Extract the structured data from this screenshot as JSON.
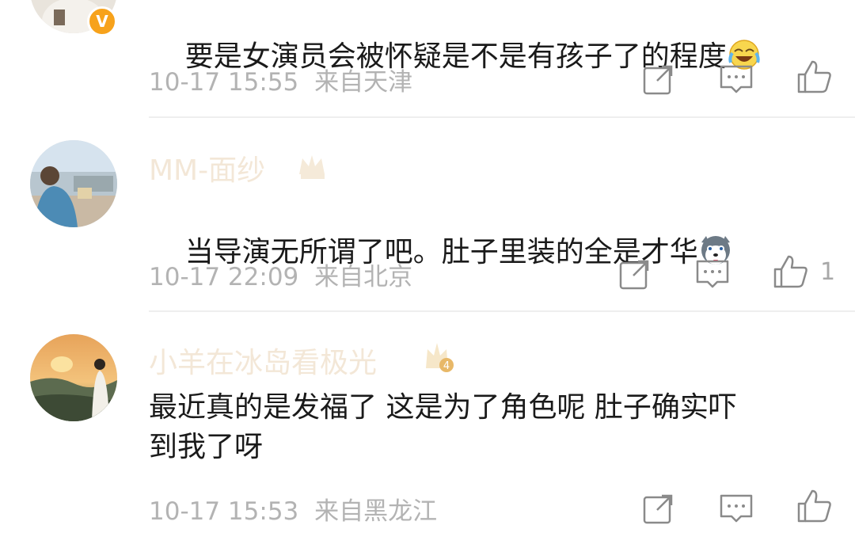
{
  "comments": [
    {
      "text": "要是女演员会被怀疑是不是有孩子了的程度",
      "emoji": "laugh-cry-emoji",
      "date": "10-17 15:55",
      "location": "来自天津",
      "likes": ""
    },
    {
      "username": "MM-面纱",
      "text": "当导演无所谓了吧。肚子里装的全是才华",
      "emoji": "husky-emoji",
      "date": "10-17 22:09",
      "location": "来自北京",
      "likes": "1"
    },
    {
      "username": "小羊在冰岛看极光",
      "level": "4",
      "text": "最近真的是发福了 这是为了角色呢 肚子确实吓\n到我了呀",
      "date": "10-17 15:53",
      "location": "来自黑龙江",
      "likes": ""
    }
  ],
  "verified_badge": "V",
  "colors": {
    "text": "#1a1a1a",
    "meta": "#b3b3b3",
    "username_faded": "#f3e7d7",
    "verified": "#f7a21b"
  }
}
